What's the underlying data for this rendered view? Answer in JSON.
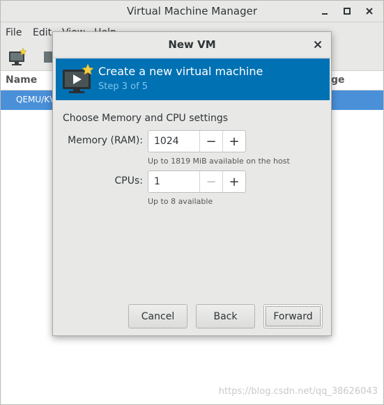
{
  "main_window": {
    "title": "Virtual Machine Manager",
    "menu": [
      "File",
      "Edit",
      "View",
      "Help"
    ],
    "columns": {
      "name": "Name",
      "usage": "ge"
    },
    "rows": [
      {
        "label": "QEMU/KV"
      }
    ]
  },
  "dialog": {
    "title": "New VM",
    "banner": {
      "title": "Create a new virtual machine",
      "step": "Step 3 of 5"
    },
    "section_title": "Choose Memory and CPU settings",
    "memory": {
      "label": "Memory (RAM):",
      "value": "1024",
      "decrement": "−",
      "increment": "+",
      "hint": "Up to 1819 MiB available on the host"
    },
    "cpus": {
      "label": "CPUs:",
      "value": "1",
      "decrement": "−",
      "increment": "+",
      "hint": "Up to 8 available"
    },
    "buttons": {
      "cancel": "Cancel",
      "back": "Back",
      "forward": "Forward"
    }
  },
  "watermark": "https://blog.csdn.net/qq_38626043",
  "colors": {
    "banner": "#0071b3",
    "selection": "#4a90d9",
    "step_text": "#80c4ec"
  }
}
